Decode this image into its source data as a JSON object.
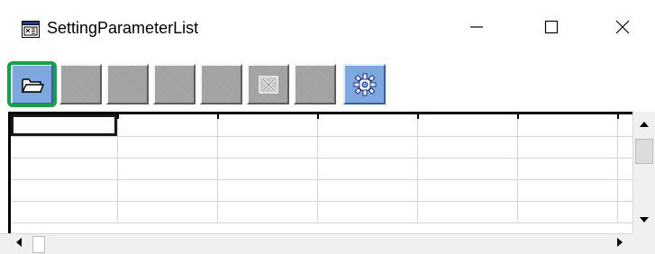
{
  "window": {
    "title": "SettingParameterList",
    "app_icon": "app-window-icon",
    "controls": [
      {
        "name": "minimize",
        "glyph": "—"
      },
      {
        "name": "maximize",
        "glyph": "☐"
      },
      {
        "name": "close",
        "glyph": "✕"
      }
    ]
  },
  "toolbar": {
    "buttons": [
      {
        "name": "open-folder",
        "icon": "folder-icon",
        "state": "active",
        "focused": true
      },
      {
        "name": "tool-2",
        "icon": "blank",
        "state": "disabled"
      },
      {
        "name": "tool-3",
        "icon": "blank",
        "state": "disabled"
      },
      {
        "name": "tool-4",
        "icon": "blank",
        "state": "disabled"
      },
      {
        "name": "tool-5",
        "icon": "blank",
        "state": "disabled"
      },
      {
        "name": "delete",
        "icon": "delete-x-icon",
        "state": "disabled"
      },
      {
        "name": "tool-7",
        "icon": "blank",
        "state": "disabled"
      },
      {
        "name": "settings",
        "icon": "gear-icon",
        "state": "active"
      }
    ],
    "focus_color": "#18a04a"
  },
  "grid": {
    "columns": 6,
    "rows": 5,
    "selected_cell": {
      "row": 0,
      "col": 0
    },
    "cells": [
      [
        "",
        "",
        "",
        "",
        "",
        ""
      ],
      [
        "",
        "",
        "",
        "",
        "",
        ""
      ],
      [
        "",
        "",
        "",
        "",
        "",
        ""
      ],
      [
        "",
        "",
        "",
        "",
        "",
        ""
      ],
      [
        "",
        "",
        "",
        "",
        "",
        ""
      ]
    ]
  },
  "scrollbars": {
    "vertical": {
      "up": "▲",
      "down": "▼"
    },
    "horizontal": {
      "left": "◀",
      "right": "▶"
    }
  },
  "colors": {
    "active_button": "#7ea7e0",
    "disabled_button": "#a4a4a4",
    "grid_line": "#d4d4d4"
  }
}
